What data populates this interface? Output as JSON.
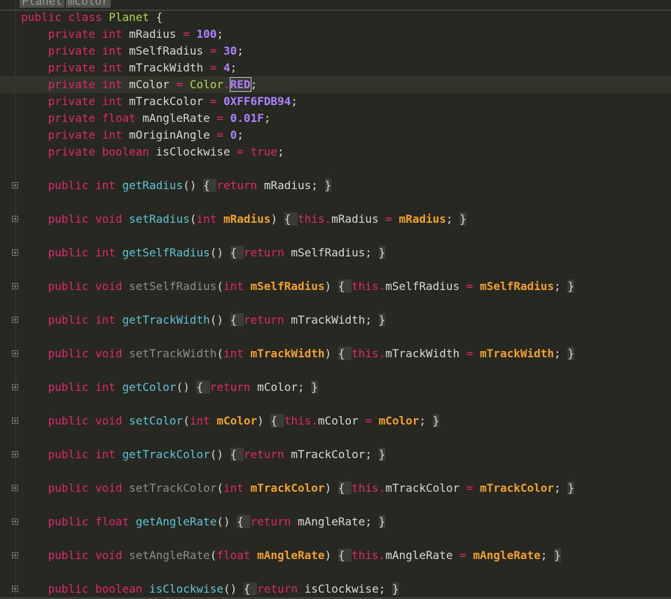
{
  "breadcrumb": [
    "Planet",
    "mColor"
  ],
  "editor": {
    "current_line": 4,
    "lines": [
      {
        "fold": false,
        "tokens": [
          [
            "kw",
            "public class "
          ],
          [
            "cls",
            "Planet"
          ],
          [
            "pl",
            " {"
          ]
        ]
      },
      {
        "fold": false,
        "tokens": [
          [
            "kw",
            "    private int "
          ],
          [
            "pl",
            "mRadius "
          ],
          [
            "op",
            "="
          ],
          [
            "pl",
            " "
          ],
          [
            "num",
            "100"
          ],
          [
            "pl",
            ";"
          ]
        ]
      },
      {
        "fold": false,
        "tokens": [
          [
            "kw",
            "    private int "
          ],
          [
            "pl",
            "mSelfRadius "
          ],
          [
            "op",
            "="
          ],
          [
            "pl",
            " "
          ],
          [
            "num",
            "30"
          ],
          [
            "pl",
            ";"
          ]
        ]
      },
      {
        "fold": false,
        "tokens": [
          [
            "kw",
            "    private int "
          ],
          [
            "pl",
            "mTrackWidth "
          ],
          [
            "op",
            "="
          ],
          [
            "pl",
            " "
          ],
          [
            "num",
            "4"
          ],
          [
            "pl",
            ";"
          ]
        ]
      },
      {
        "fold": false,
        "tokens": [
          [
            "kw",
            "    private int "
          ],
          [
            "pl",
            "mColor "
          ],
          [
            "op",
            "="
          ],
          [
            "pl",
            " "
          ],
          [
            "cls",
            "Color"
          ],
          [
            "op",
            "."
          ],
          [
            "cst",
            "RED"
          ],
          [
            "pl",
            ";"
          ]
        ]
      },
      {
        "fold": false,
        "tokens": [
          [
            "kw",
            "    private int "
          ],
          [
            "pl",
            "mTrackColor "
          ],
          [
            "op",
            "="
          ],
          [
            "pl",
            " "
          ],
          [
            "num",
            "0XFF6FDB94"
          ],
          [
            "pl",
            ";"
          ]
        ]
      },
      {
        "fold": false,
        "tokens": [
          [
            "kw",
            "    private float "
          ],
          [
            "pl",
            "mAngleRate "
          ],
          [
            "op",
            "="
          ],
          [
            "pl",
            " "
          ],
          [
            "num",
            "0.01F"
          ],
          [
            "pl",
            ";"
          ]
        ]
      },
      {
        "fold": false,
        "tokens": [
          [
            "kw",
            "    private int "
          ],
          [
            "pl",
            "mOriginAngle "
          ],
          [
            "op",
            "="
          ],
          [
            "pl",
            " "
          ],
          [
            "num",
            "0"
          ],
          [
            "pl",
            ";"
          ]
        ]
      },
      {
        "fold": false,
        "tokens": [
          [
            "kw",
            "    private boolean "
          ],
          [
            "pl",
            "isClockwise "
          ],
          [
            "op",
            "="
          ],
          [
            "pl",
            " "
          ],
          [
            "kw",
            "true"
          ],
          [
            "pl",
            ";"
          ]
        ]
      },
      {
        "fold": false,
        "tokens": []
      },
      {
        "fold": true,
        "tokens": [
          [
            "kw",
            "    public int "
          ],
          [
            "fn",
            "getRadius"
          ],
          [
            "pl",
            "() "
          ],
          [
            "brk",
            "{ "
          ],
          [
            "kw",
            "return "
          ],
          [
            "pl",
            "mRadius; "
          ],
          [
            "brk",
            "}"
          ]
        ]
      },
      {
        "fold": false,
        "tokens": []
      },
      {
        "fold": true,
        "tokens": [
          [
            "kw",
            "    public void "
          ],
          [
            "fn",
            "setRadius"
          ],
          [
            "pl",
            "("
          ],
          [
            "kw",
            "int "
          ],
          [
            "par",
            "mRadius"
          ],
          [
            "pl",
            ") "
          ],
          [
            "brk",
            "{ "
          ],
          [
            "kw",
            "this"
          ],
          [
            "op",
            "."
          ],
          [
            "pl",
            "mRadius "
          ],
          [
            "op",
            "="
          ],
          [
            "pl",
            " "
          ],
          [
            "par",
            "mRadius"
          ],
          [
            "pl",
            "; "
          ],
          [
            "brk",
            "}"
          ]
        ]
      },
      {
        "fold": false,
        "tokens": []
      },
      {
        "fold": true,
        "tokens": [
          [
            "kw",
            "    public int "
          ],
          [
            "fn",
            "getSelfRadius"
          ],
          [
            "pl",
            "() "
          ],
          [
            "brk",
            "{ "
          ],
          [
            "kw",
            "return "
          ],
          [
            "pl",
            "mSelfRadius; "
          ],
          [
            "brk",
            "}"
          ]
        ]
      },
      {
        "fold": false,
        "tokens": []
      },
      {
        "fold": true,
        "tokens": [
          [
            "kw",
            "    public void "
          ],
          [
            "fnd",
            "setSelfRadius"
          ],
          [
            "pl",
            "("
          ],
          [
            "kw",
            "int "
          ],
          [
            "par",
            "mSelfRadius"
          ],
          [
            "pl",
            ") "
          ],
          [
            "brk",
            "{ "
          ],
          [
            "kw",
            "this"
          ],
          [
            "op",
            "."
          ],
          [
            "pl",
            "mSelfRadius "
          ],
          [
            "op",
            "="
          ],
          [
            "pl",
            " "
          ],
          [
            "par",
            "mSelfRadius"
          ],
          [
            "pl",
            "; "
          ],
          [
            "brk",
            "}"
          ]
        ]
      },
      {
        "fold": false,
        "tokens": []
      },
      {
        "fold": true,
        "tokens": [
          [
            "kw",
            "    public int "
          ],
          [
            "fn",
            "getTrackWidth"
          ],
          [
            "pl",
            "() "
          ],
          [
            "brk",
            "{ "
          ],
          [
            "kw",
            "return "
          ],
          [
            "pl",
            "mTrackWidth; "
          ],
          [
            "brk",
            "}"
          ]
        ]
      },
      {
        "fold": false,
        "tokens": []
      },
      {
        "fold": true,
        "tokens": [
          [
            "kw",
            "    public void "
          ],
          [
            "fnd",
            "setTrackWidth"
          ],
          [
            "pl",
            "("
          ],
          [
            "kw",
            "int "
          ],
          [
            "par",
            "mTrackWidth"
          ],
          [
            "pl",
            ") "
          ],
          [
            "brk",
            "{ "
          ],
          [
            "kw",
            "this"
          ],
          [
            "op",
            "."
          ],
          [
            "pl",
            "mTrackWidth "
          ],
          [
            "op",
            "="
          ],
          [
            "pl",
            " "
          ],
          [
            "par",
            "mTrackWidth"
          ],
          [
            "pl",
            "; "
          ],
          [
            "brk",
            "}"
          ]
        ]
      },
      {
        "fold": false,
        "tokens": []
      },
      {
        "fold": true,
        "tokens": [
          [
            "kw",
            "    public int "
          ],
          [
            "fn",
            "getColor"
          ],
          [
            "pl",
            "() "
          ],
          [
            "brk",
            "{ "
          ],
          [
            "kw",
            "return "
          ],
          [
            "pl",
            "mColor; "
          ],
          [
            "brk",
            "}"
          ]
        ]
      },
      {
        "fold": false,
        "tokens": []
      },
      {
        "fold": true,
        "tokens": [
          [
            "kw",
            "    public void "
          ],
          [
            "fn",
            "setColor"
          ],
          [
            "pl",
            "("
          ],
          [
            "kw",
            "int "
          ],
          [
            "par",
            "mColor"
          ],
          [
            "pl",
            ") "
          ],
          [
            "brk",
            "{ "
          ],
          [
            "kw",
            "this"
          ],
          [
            "op",
            "."
          ],
          [
            "pl",
            "mColor "
          ],
          [
            "op",
            "="
          ],
          [
            "pl",
            " "
          ],
          [
            "par",
            "mColor"
          ],
          [
            "pl",
            "; "
          ],
          [
            "brk",
            "}"
          ]
        ]
      },
      {
        "fold": false,
        "tokens": []
      },
      {
        "fold": true,
        "tokens": [
          [
            "kw",
            "    public int "
          ],
          [
            "fn",
            "getTrackColor"
          ],
          [
            "pl",
            "() "
          ],
          [
            "brk",
            "{ "
          ],
          [
            "kw",
            "return "
          ],
          [
            "pl",
            "mTrackColor; "
          ],
          [
            "brk",
            "}"
          ]
        ]
      },
      {
        "fold": false,
        "tokens": []
      },
      {
        "fold": true,
        "tokens": [
          [
            "kw",
            "    public void "
          ],
          [
            "fnd",
            "setTrackColor"
          ],
          [
            "pl",
            "("
          ],
          [
            "kw",
            "int "
          ],
          [
            "par",
            "mTrackColor"
          ],
          [
            "pl",
            ") "
          ],
          [
            "brk",
            "{ "
          ],
          [
            "kw",
            "this"
          ],
          [
            "op",
            "."
          ],
          [
            "pl",
            "mTrackColor "
          ],
          [
            "op",
            "="
          ],
          [
            "pl",
            " "
          ],
          [
            "par",
            "mTrackColor"
          ],
          [
            "pl",
            "; "
          ],
          [
            "brk",
            "}"
          ]
        ]
      },
      {
        "fold": false,
        "tokens": []
      },
      {
        "fold": true,
        "tokens": [
          [
            "kw",
            "    public float "
          ],
          [
            "fn",
            "getAngleRate"
          ],
          [
            "pl",
            "() "
          ],
          [
            "brk",
            "{ "
          ],
          [
            "kw",
            "return "
          ],
          [
            "pl",
            "mAngleRate; "
          ],
          [
            "brk",
            "}"
          ]
        ]
      },
      {
        "fold": false,
        "tokens": []
      },
      {
        "fold": true,
        "tokens": [
          [
            "kw",
            "    public void "
          ],
          [
            "fnd",
            "setAngleRate"
          ],
          [
            "pl",
            "("
          ],
          [
            "kw",
            "float "
          ],
          [
            "par",
            "mAngleRate"
          ],
          [
            "pl",
            ") "
          ],
          [
            "brk",
            "{ "
          ],
          [
            "kw",
            "this"
          ],
          [
            "op",
            "."
          ],
          [
            "pl",
            "mAngleRate "
          ],
          [
            "op",
            "="
          ],
          [
            "pl",
            " "
          ],
          [
            "par",
            "mAngleRate"
          ],
          [
            "pl",
            "; "
          ],
          [
            "brk",
            "}"
          ]
        ]
      },
      {
        "fold": false,
        "tokens": []
      },
      {
        "fold": true,
        "tokens": [
          [
            "kw",
            "    public boolean "
          ],
          [
            "fn",
            "isClockwise"
          ],
          [
            "pl",
            "() "
          ],
          [
            "brk",
            "{ "
          ],
          [
            "kw",
            "return "
          ],
          [
            "pl",
            "isClockwise; "
          ],
          [
            "brk",
            "}"
          ]
        ]
      }
    ]
  },
  "colors": {
    "background": "#272822",
    "current_line": "#32332b",
    "keyword": "#e0286e",
    "number": "#ad81ff",
    "class_name": "#b4d84e",
    "function": "#5fc3d8",
    "parameter": "#f0a22c",
    "text": "#d9d9d2"
  }
}
